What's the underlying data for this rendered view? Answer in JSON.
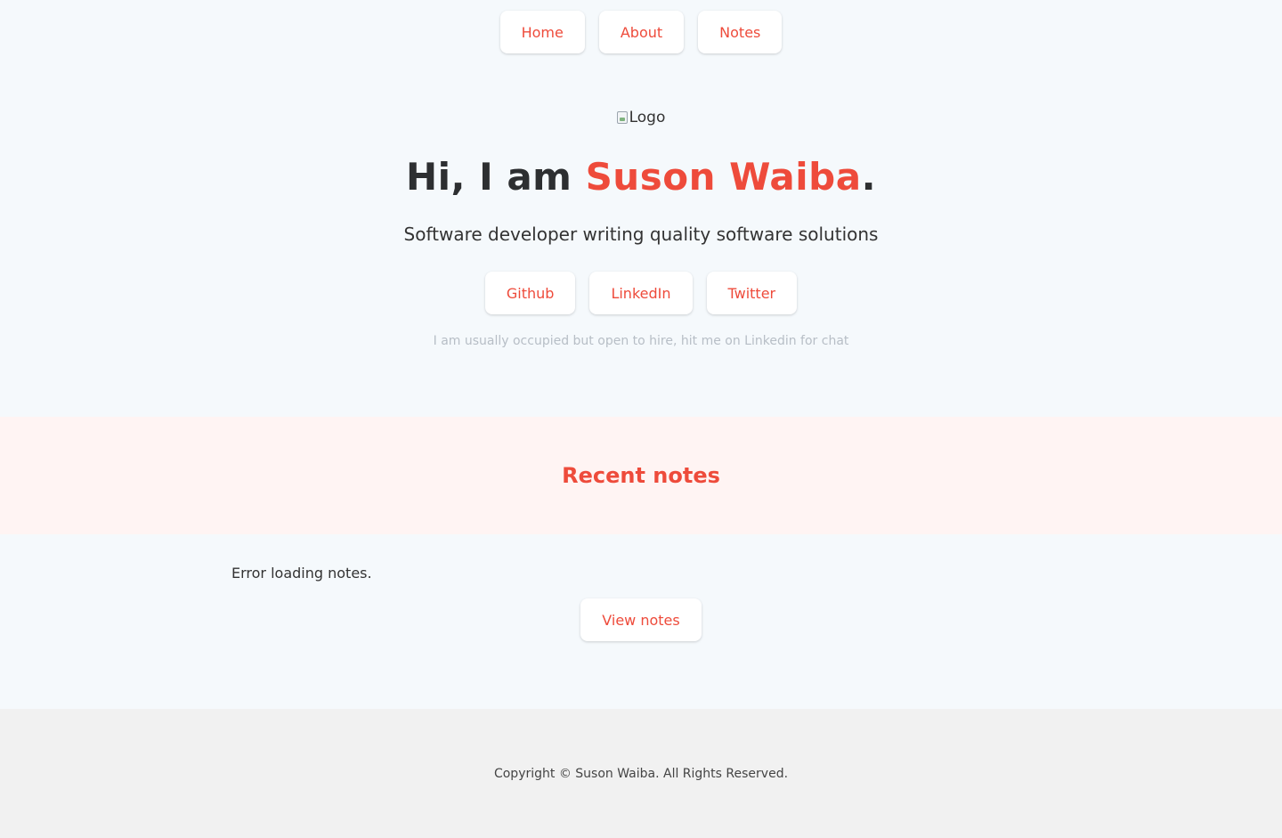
{
  "nav": {
    "items": [
      {
        "label": "Home"
      },
      {
        "label": "About"
      },
      {
        "label": "Notes"
      }
    ]
  },
  "hero": {
    "logo_alt": "Logo",
    "greeting": "Hi, I am ",
    "name": "Suson Waiba",
    "punct": ".",
    "tagline": "Software developer writing quality software solutions",
    "socials": [
      {
        "label": "Github"
      },
      {
        "label": "LinkedIn"
      },
      {
        "label": "Twitter"
      }
    ],
    "hint": "I am usually occupied but open to hire, hit me on Linkedin for chat"
  },
  "recent": {
    "title": "Recent notes",
    "error": "Error loading notes.",
    "view_label": "View notes"
  },
  "footer": {
    "copyright": "Copyright © Suson Waiba. All Rights Reserved."
  },
  "colors": {
    "accent": "#ee4b3b",
    "page_bg": "#f5f9fc",
    "band_bg": "#fff4f3",
    "footer_bg": "#f1f1f1"
  }
}
